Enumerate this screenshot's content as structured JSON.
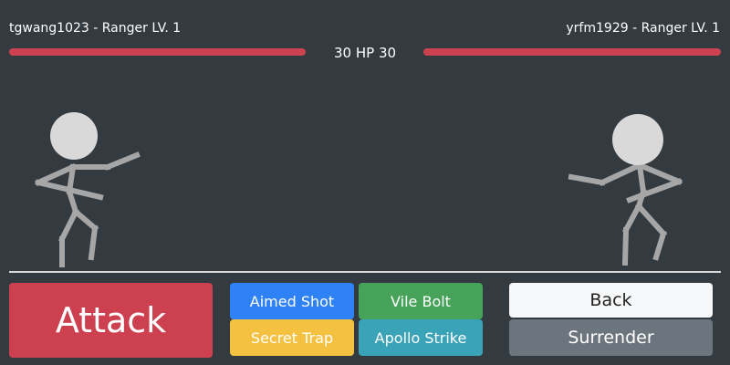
{
  "players": {
    "left": {
      "name_line": "tgwang1023 - Ranger LV. 1",
      "hp": 30,
      "hp_fraction": 1.0
    },
    "right": {
      "name_line": "yrfm1929 - Ranger LV. 1",
      "hp": 30,
      "hp_fraction": 1.0
    }
  },
  "hp_label": "HP",
  "colors": {
    "background": "#333a40",
    "hp_bar": "#cc4250",
    "stick_figure": "#a6a6a6",
    "head": "#d9d9d9",
    "ground": "#d9d9d9"
  },
  "actions": {
    "attack": {
      "label": "Attack",
      "color": "#cd4050"
    },
    "skills": [
      {
        "label": "Aimed Shot",
        "color": "#2e82f5"
      },
      {
        "label": "Vile Bolt",
        "color": "#47a35a"
      },
      {
        "label": "Secret Trap",
        "color": "#f5c140"
      },
      {
        "label": "Apollo Strike",
        "color": "#3aa3b8"
      }
    ],
    "back": {
      "label": "Back",
      "color": "#f7f8f9"
    },
    "surrender": {
      "label": "Surrender",
      "color": "#6c757e"
    }
  }
}
